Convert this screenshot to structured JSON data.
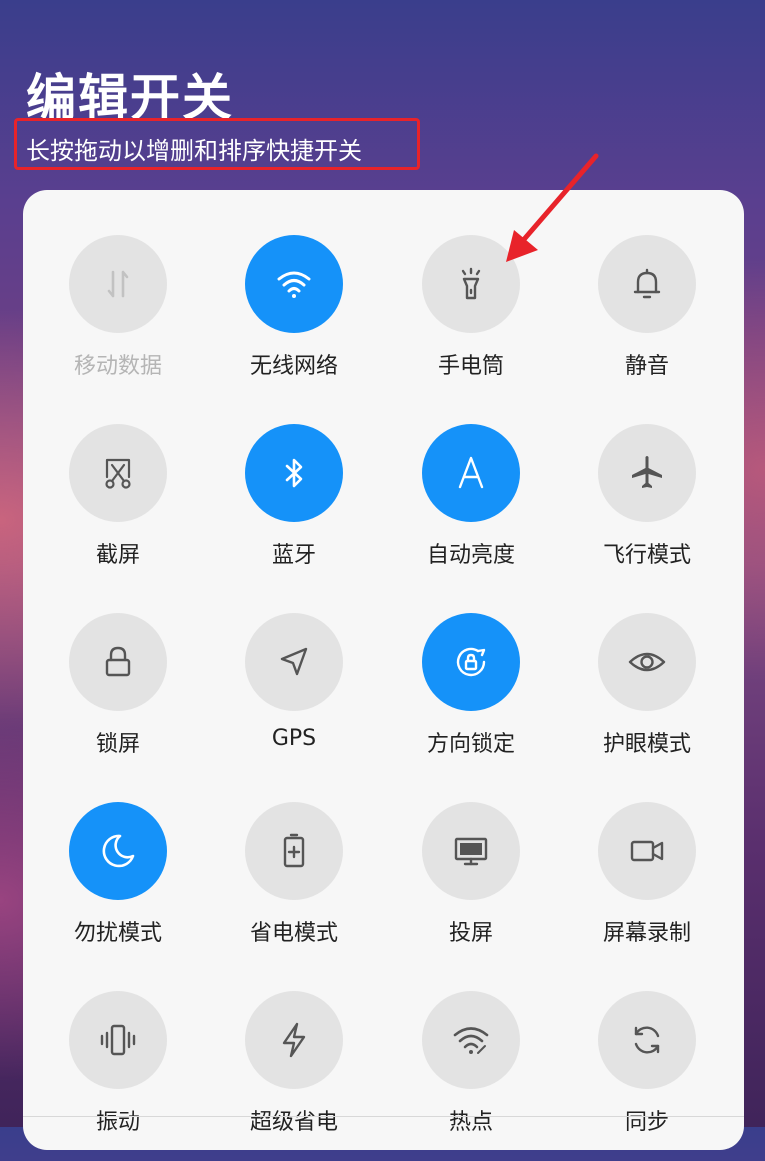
{
  "header": {
    "title": "编辑开关",
    "subtitle": "长按拖动以增删和排序快捷开关"
  },
  "colors": {
    "accent": "#1592f9",
    "annotation": "#e8232a",
    "tile_off": "#e3e3e3"
  },
  "tiles": [
    {
      "label": "移动数据",
      "icon": "mobile-data-icon",
      "active": false,
      "disabled": true
    },
    {
      "label": "无线网络",
      "icon": "wifi-icon",
      "active": true,
      "disabled": false
    },
    {
      "label": "手电筒",
      "icon": "flashlight-icon",
      "active": false,
      "disabled": false
    },
    {
      "label": "静音",
      "icon": "bell-icon",
      "active": false,
      "disabled": false
    },
    {
      "label": "截屏",
      "icon": "screenshot-icon",
      "active": false,
      "disabled": false
    },
    {
      "label": "蓝牙",
      "icon": "bluetooth-icon",
      "active": true,
      "disabled": false
    },
    {
      "label": "自动亮度",
      "icon": "auto-brightness-icon",
      "active": true,
      "disabled": false
    },
    {
      "label": "飞行模式",
      "icon": "airplane-icon",
      "active": false,
      "disabled": false
    },
    {
      "label": "锁屏",
      "icon": "lock-icon",
      "active": false,
      "disabled": false
    },
    {
      "label": "GPS",
      "icon": "location-arrow-icon",
      "active": false,
      "disabled": false
    },
    {
      "label": "方向锁定",
      "icon": "rotation-lock-icon",
      "active": true,
      "disabled": false
    },
    {
      "label": "护眼模式",
      "icon": "eye-icon",
      "active": false,
      "disabled": false
    },
    {
      "label": "勿扰模式",
      "icon": "moon-icon",
      "active": true,
      "disabled": false
    },
    {
      "label": "省电模式",
      "icon": "battery-saver-icon",
      "active": false,
      "disabled": false
    },
    {
      "label": "投屏",
      "icon": "monitor-icon",
      "active": false,
      "disabled": false
    },
    {
      "label": "屏幕录制",
      "icon": "video-camera-icon",
      "active": false,
      "disabled": false
    },
    {
      "label": "振动",
      "icon": "vibrate-icon",
      "active": false,
      "disabled": false
    },
    {
      "label": "超级省电",
      "icon": "lightning-icon",
      "active": false,
      "disabled": false
    },
    {
      "label": "热点",
      "icon": "hotspot-icon",
      "active": false,
      "disabled": false
    },
    {
      "label": "同步",
      "icon": "sync-icon",
      "active": false,
      "disabled": false
    }
  ]
}
